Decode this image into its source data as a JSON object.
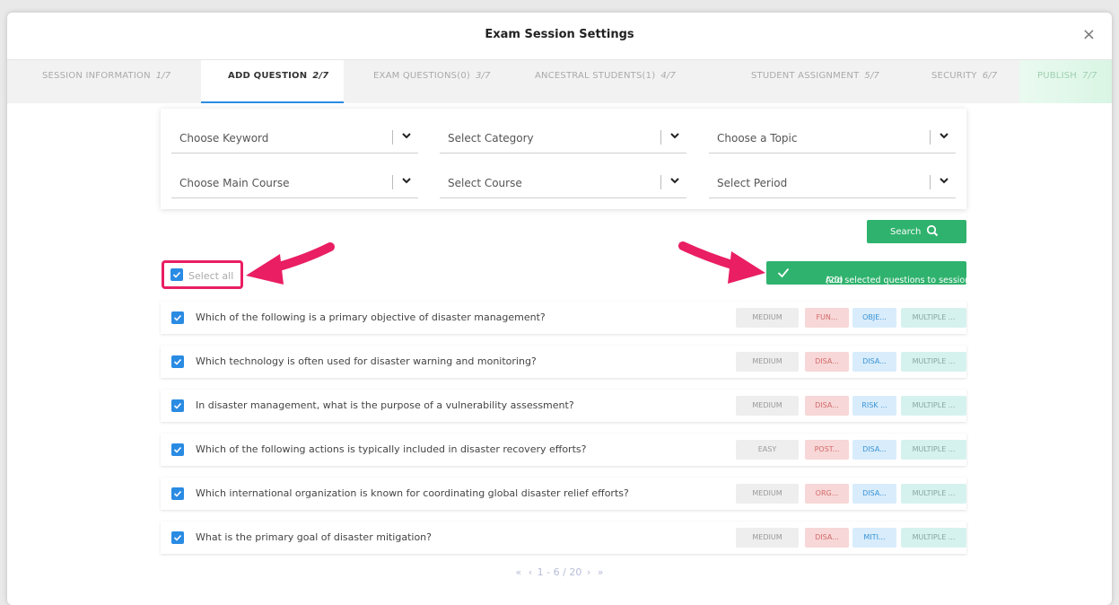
{
  "modal": {
    "title": "Exam Session Settings",
    "close_glyph": "×"
  },
  "tabs": [
    {
      "label": "SESSION INFORMATION",
      "step": "1/7"
    },
    {
      "label": "ADD QUESTION",
      "step": "2/7"
    },
    {
      "label": "EXAM QUESTIONS(0)",
      "step": "3/7"
    },
    {
      "label": "ANCESTRAL STUDENTS(1)",
      "step": "4/7"
    },
    {
      "label": "STUDENT ASSIGNMENT",
      "step": "5/7"
    },
    {
      "label": "SECURITY",
      "step": "6/7"
    },
    {
      "label": "PUBLISH",
      "step": "7/7"
    }
  ],
  "filters": {
    "keyword": "Choose Keyword",
    "category": "Select Category",
    "topic": "Choose a Topic",
    "main_course": "Choose Main Course",
    "course": "Select Course",
    "period": "Select Period"
  },
  "search_label": "Search",
  "select_all_label": "Select all",
  "add_label": "Add selected questions to session",
  "add_count": "(20)",
  "questions": [
    {
      "text": "Which of the following is a primary objective of disaster management?",
      "level": "MEDIUM",
      "category": "FUN...",
      "topic": "OBJE...",
      "type": "MULTIPLE ..."
    },
    {
      "text": "Which technology is often used for disaster warning and monitoring?",
      "level": "MEDIUM",
      "category": "DISA...",
      "topic": "DISA...",
      "type": "MULTIPLE ..."
    },
    {
      "text": "In disaster management, what is the purpose of a vulnerability assessment?",
      "level": "MEDIUM",
      "category": "DISA...",
      "topic": "RISK ...",
      "type": "MULTIPLE ..."
    },
    {
      "text": "Which of the following actions is typically included in disaster recovery efforts?",
      "level": "EASY",
      "category": "POST...",
      "topic": "DISA...",
      "type": "MULTIPLE ..."
    },
    {
      "text": "Which international organization is known for coordinating global disaster relief efforts?",
      "level": "MEDIUM",
      "category": "ORG...",
      "topic": "DISA...",
      "type": "MULTIPLE ..."
    },
    {
      "text": "What is the primary goal of disaster mitigation?",
      "level": "MEDIUM",
      "category": "DISA...",
      "topic": "MITI...",
      "type": "MULTIPLE ..."
    }
  ],
  "pagination": {
    "first": "«",
    "prev": "‹",
    "range": "1 - 6 / 20",
    "next": "›",
    "last": "»"
  },
  "colors": {
    "accent_blue": "#2a8be3",
    "green": "#2fb26d",
    "annotation_pink": "#e91e63"
  }
}
